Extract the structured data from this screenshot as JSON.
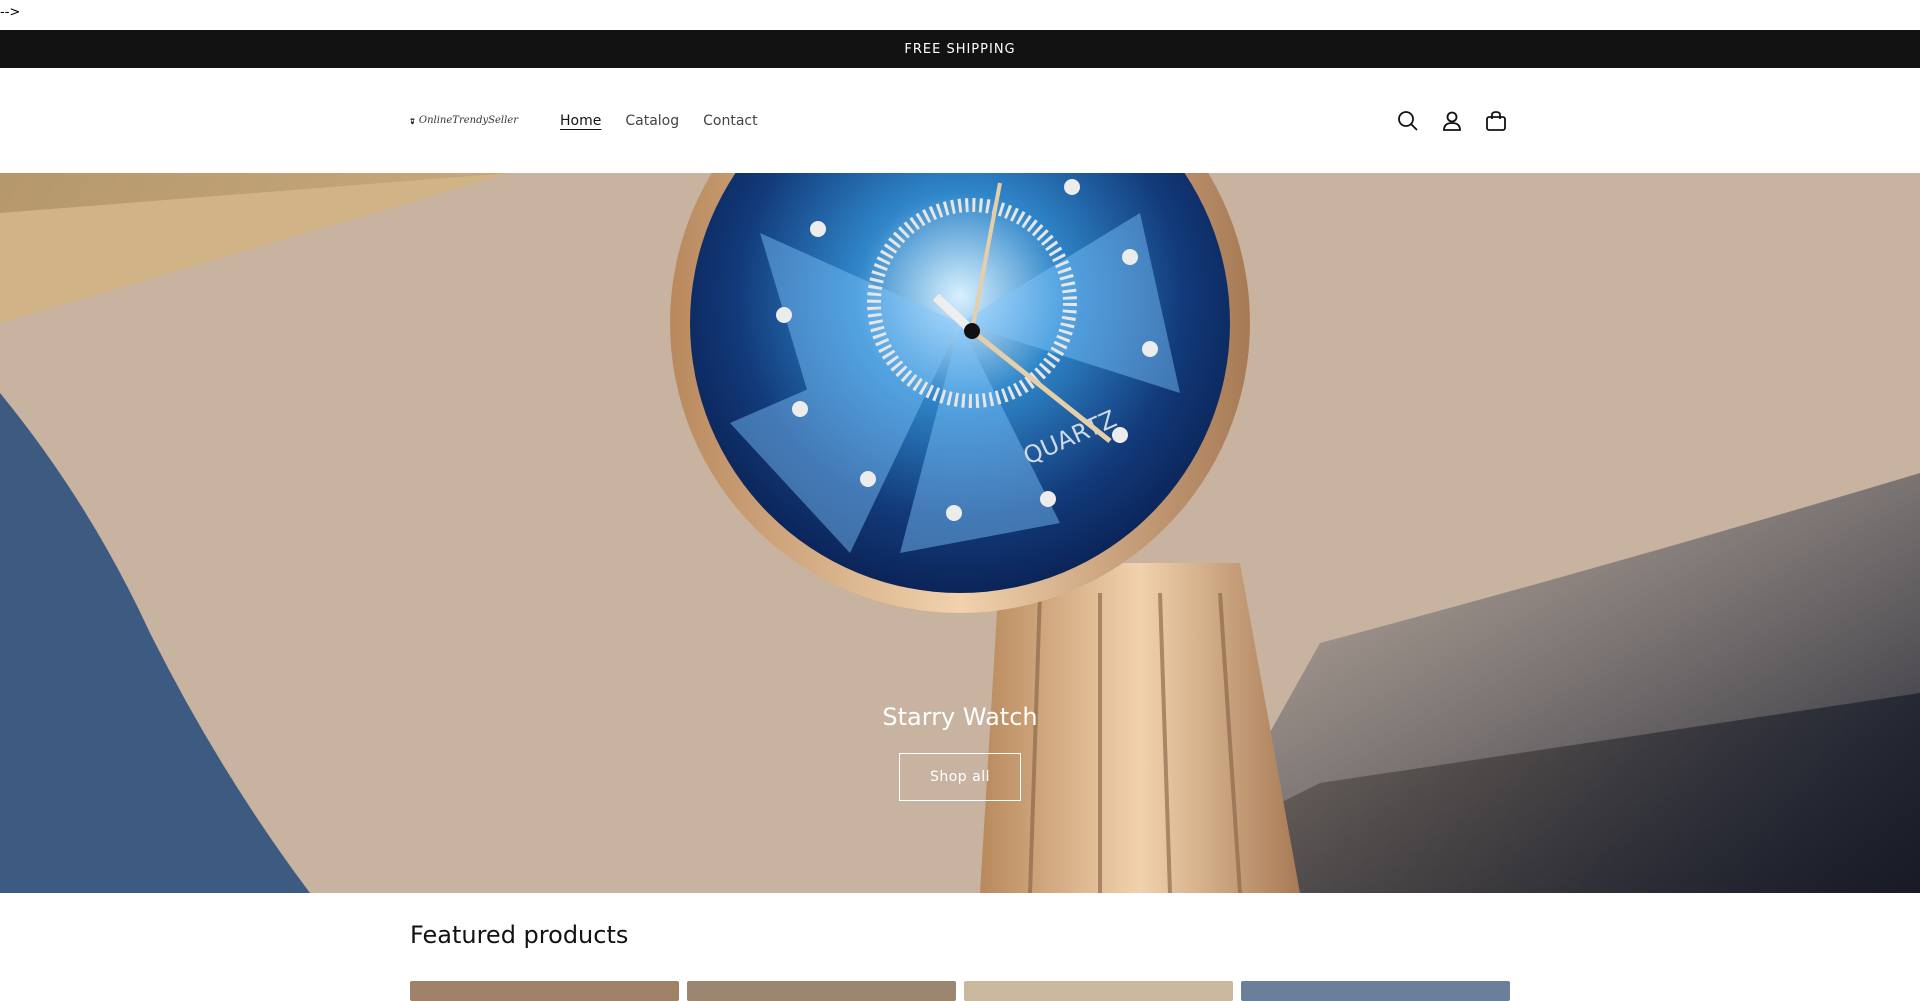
{
  "stray": {
    "text": "-->"
  },
  "announcement": {
    "text": "FREE SHIPPING"
  },
  "header": {
    "logo_text": "OnlineTrendySeller",
    "nav": [
      {
        "label": "Home",
        "active": true
      },
      {
        "label": "Catalog",
        "active": false
      },
      {
        "label": "Contact",
        "active": false
      }
    ],
    "icons": [
      "search-icon",
      "account-icon",
      "cart-icon"
    ]
  },
  "hero": {
    "title": "Starry Watch",
    "button_label": "Shop all",
    "watch_text": "QUARTZ"
  },
  "featured": {
    "title": "Featured products",
    "product_colors": [
      "#a08268",
      "#9c8670",
      "#c9b89e",
      "#6c7f9a"
    ]
  },
  "colors": {
    "announcement_bg": "#121212",
    "text": "#121212",
    "watch_blue": "#1e5fa8",
    "watch_gold": "#d7b48a"
  }
}
